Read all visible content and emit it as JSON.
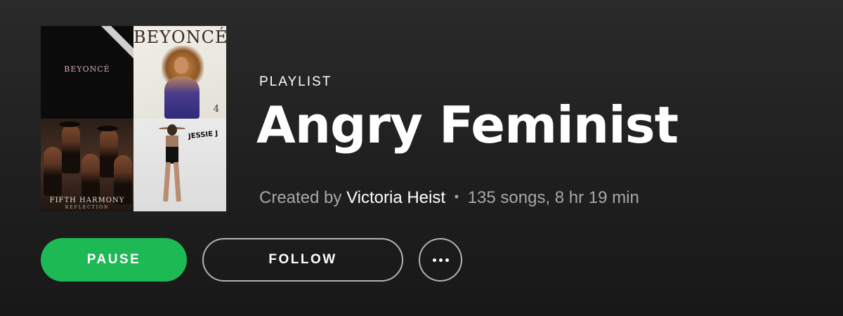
{
  "cover": {
    "tiles": [
      {
        "album_text": "BEYONCÉ",
        "icon": "album-art-beyonce-platinum"
      },
      {
        "album_text": "BEYONCÉ",
        "number": "4",
        "icon": "album-art-beyonce-4"
      },
      {
        "album_text": "FIFTH HARMONY",
        "subtitle": "REFLECTION",
        "icon": "album-art-fifth-harmony-reflection"
      },
      {
        "album_text": "JESSIE J",
        "icon": "album-art-jessie-j"
      }
    ]
  },
  "playlist": {
    "type_label": "PLAYLIST",
    "title": "Angry Feminist",
    "created_by_prefix": "Created by",
    "creator": "Victoria Heist",
    "separator": "•",
    "stats": "135 songs, 8 hr 19 min"
  },
  "actions": {
    "pause_label": "PAUSE",
    "follow_label": "FOLLOW",
    "more_icon": "ellipsis-icon"
  },
  "colors": {
    "accent": "#1db954",
    "background": "#1f1f1f",
    "muted_text": "#a8a8a8"
  }
}
